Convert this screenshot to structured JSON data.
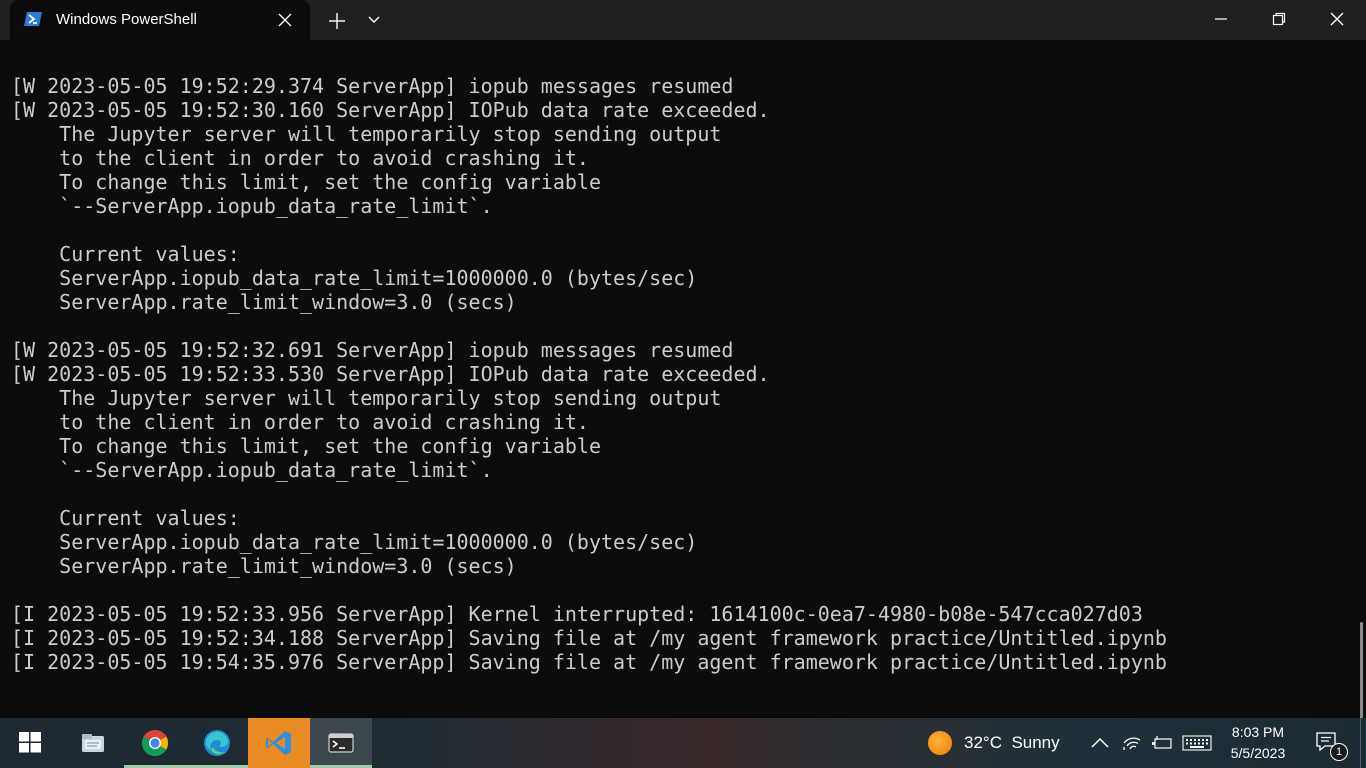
{
  "window": {
    "tab_title": "Windows PowerShell"
  },
  "terminal": {
    "lines": [
      "[W 2023-05-05 19:52:29.374 ServerApp] iopub messages resumed",
      "[W 2023-05-05 19:52:30.160 ServerApp] IOPub data rate exceeded.",
      "    The Jupyter server will temporarily stop sending output",
      "    to the client in order to avoid crashing it.",
      "    To change this limit, set the config variable",
      "    `--ServerApp.iopub_data_rate_limit`.",
      "",
      "    Current values:",
      "    ServerApp.iopub_data_rate_limit=1000000.0 (bytes/sec)",
      "    ServerApp.rate_limit_window=3.0 (secs)",
      "",
      "[W 2023-05-05 19:52:32.691 ServerApp] iopub messages resumed",
      "[W 2023-05-05 19:52:33.530 ServerApp] IOPub data rate exceeded.",
      "    The Jupyter server will temporarily stop sending output",
      "    to the client in order to avoid crashing it.",
      "    To change this limit, set the config variable",
      "    `--ServerApp.iopub_data_rate_limit`.",
      "",
      "    Current values:",
      "    ServerApp.iopub_data_rate_limit=1000000.0 (bytes/sec)",
      "    ServerApp.rate_limit_window=3.0 (secs)",
      "",
      "[I 2023-05-05 19:52:33.956 ServerApp] Kernel interrupted: 1614100c-0ea7-4980-b08e-547cca027d03",
      "[I 2023-05-05 19:52:34.188 ServerApp] Saving file at /my agent framework practice/Untitled.ipynb",
      "[I 2023-05-05 19:54:35.976 ServerApp] Saving file at /my agent framework practice/Untitled.ipynb"
    ]
  },
  "taskbar": {
    "apps": [
      {
        "name": "start-button",
        "icon": "windows-logo-icon"
      },
      {
        "name": "file-explorer",
        "icon": "folder-icon"
      },
      {
        "name": "chrome",
        "icon": "chrome-icon"
      },
      {
        "name": "edge",
        "icon": "edge-icon"
      },
      {
        "name": "vscode",
        "icon": "vscode-icon"
      },
      {
        "name": "terminal",
        "icon": "terminal-icon"
      }
    ],
    "weather": {
      "temp": "32°C",
      "condition": "Sunny"
    },
    "clock": {
      "time": "8:03 PM",
      "date": "5/5/2023"
    },
    "notifications_count": "1"
  },
  "colors": {
    "terminal_bg": "#0c0c0c",
    "terminal_fg": "#cccccc",
    "titlebar_bg": "#202020",
    "vscode_accent": "#ea8a24"
  }
}
